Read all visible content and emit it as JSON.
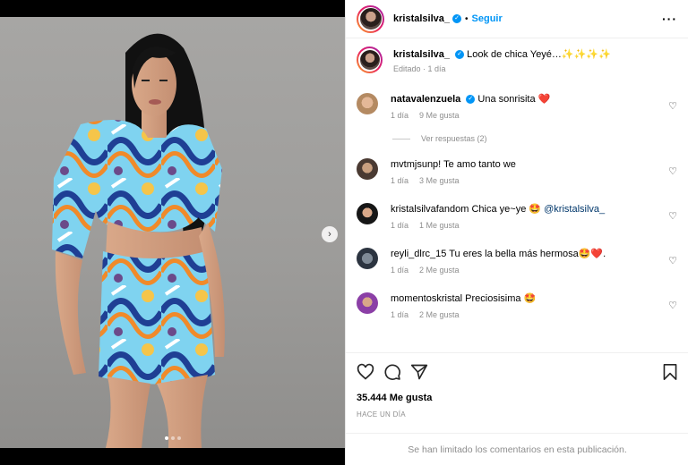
{
  "post": {
    "author": "kristalsilva_",
    "follow_label": "Seguir",
    "caption_author": "kristalsilva_",
    "caption_text": "Look de chica Yeyé…✨✨✨✨",
    "caption_meta": "Editado · 1 día",
    "likes": "35.444 Me gusta",
    "date": "HACE UN DÍA",
    "footer_notice": "Se han limitado los comentarios en esta publicación."
  },
  "comments": [
    {
      "user": "natavalenzuela",
      "verified": true,
      "text": "Una sonrisita ❤️",
      "time": "1 día",
      "likes": "9 Me gusta",
      "replies": "Ver respuestas (2)"
    },
    {
      "user": "mvtmjsunp!",
      "verified": false,
      "text": "Te amo tanto we",
      "time": "1 día",
      "likes": "3 Me gusta"
    },
    {
      "user": "kristalsilvafandom",
      "verified": false,
      "text": "Chica ye~ye 🤩",
      "mention": "@kristalsilva_",
      "time": "1 día",
      "likes": "1 Me gusta"
    },
    {
      "user": "reyli_dlrc_15",
      "verified": false,
      "text": "Tu eres la bella más hermosa🤩❤️.",
      "time": "1 día",
      "likes": "2 Me gusta"
    },
    {
      "user": "momentoskristal",
      "verified": false,
      "text": "Preciosisima 🤩",
      "time": "1 día",
      "likes": "2 Me gusta"
    }
  ],
  "icons": {
    "like": "heart-icon",
    "comment": "comment-icon",
    "share": "share-icon",
    "save": "bookmark-icon",
    "more": "more-options-icon",
    "next": "chevron-right-icon"
  },
  "colors": {
    "accent": "#0095f6",
    "muted": "#8e8e8e",
    "heart": "#ed4956"
  }
}
